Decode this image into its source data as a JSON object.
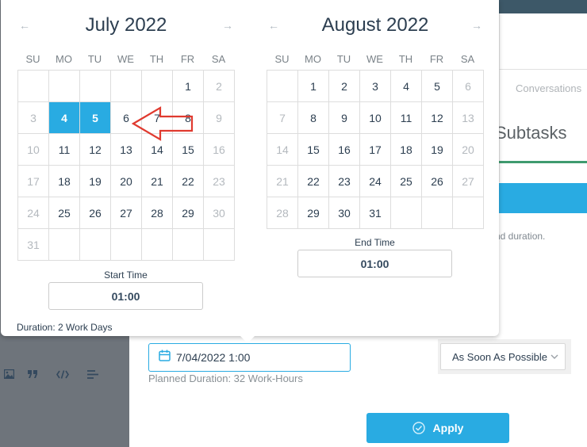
{
  "background": {
    "tab_conversations": "Conversations",
    "section_subtasks": "Subtasks",
    "duration_note": "nd duration."
  },
  "editor_toolbar": {
    "icons": [
      "image-icon",
      "quote-icon",
      "code-icon",
      "align-left-icon"
    ]
  },
  "scheduling": {
    "date_value": "7/04/2022 1:00",
    "planned_duration": "Planned Duration: 32 Work-Hours",
    "constraint": "As Soon As Possible",
    "apply_label": "Apply"
  },
  "picker": {
    "calendars": [
      {
        "title": "July 2022",
        "weekdays": [
          "SU",
          "MO",
          "TU",
          "WE",
          "TH",
          "FR",
          "SA"
        ],
        "weeks": [
          [
            {
              "t": ""
            },
            {
              "t": ""
            },
            {
              "t": ""
            },
            {
              "t": ""
            },
            {
              "t": ""
            },
            {
              "t": "1"
            },
            {
              "t": "2",
              "m": true
            }
          ],
          [
            {
              "t": "3",
              "m": true
            },
            {
              "t": "4",
              "s": true
            },
            {
              "t": "5",
              "s": true
            },
            {
              "t": "6"
            },
            {
              "t": "7"
            },
            {
              "t": "8"
            },
            {
              "t": "9",
              "m": true
            }
          ],
          [
            {
              "t": "10",
              "m": true
            },
            {
              "t": "11"
            },
            {
              "t": "12"
            },
            {
              "t": "13"
            },
            {
              "t": "14"
            },
            {
              "t": "15"
            },
            {
              "t": "16",
              "m": true
            }
          ],
          [
            {
              "t": "17",
              "m": true
            },
            {
              "t": "18"
            },
            {
              "t": "19"
            },
            {
              "t": "20"
            },
            {
              "t": "21"
            },
            {
              "t": "22"
            },
            {
              "t": "23",
              "m": true
            }
          ],
          [
            {
              "t": "24",
              "m": true
            },
            {
              "t": "25"
            },
            {
              "t": "26"
            },
            {
              "t": "27"
            },
            {
              "t": "28"
            },
            {
              "t": "29"
            },
            {
              "t": "30",
              "m": true
            }
          ],
          [
            {
              "t": "31",
              "m": true
            },
            {
              "t": ""
            },
            {
              "t": ""
            },
            {
              "t": ""
            },
            {
              "t": ""
            },
            {
              "t": ""
            },
            {
              "t": ""
            }
          ]
        ],
        "time_label": "Start Time",
        "time_value": "01:00"
      },
      {
        "title": "August 2022",
        "weekdays": [
          "SU",
          "MO",
          "TU",
          "WE",
          "TH",
          "FR",
          "SA"
        ],
        "weeks": [
          [
            {
              "t": ""
            },
            {
              "t": "1"
            },
            {
              "t": "2"
            },
            {
              "t": "3"
            },
            {
              "t": "4"
            },
            {
              "t": "5"
            },
            {
              "t": "6",
              "m": true
            }
          ],
          [
            {
              "t": "7",
              "m": true
            },
            {
              "t": "8"
            },
            {
              "t": "9"
            },
            {
              "t": "10"
            },
            {
              "t": "11"
            },
            {
              "t": "12"
            },
            {
              "t": "13",
              "m": true
            }
          ],
          [
            {
              "t": "14",
              "m": true
            },
            {
              "t": "15"
            },
            {
              "t": "16"
            },
            {
              "t": "17"
            },
            {
              "t": "18"
            },
            {
              "t": "19"
            },
            {
              "t": "20",
              "m": true
            }
          ],
          [
            {
              "t": "21",
              "m": true
            },
            {
              "t": "22"
            },
            {
              "t": "23"
            },
            {
              "t": "24"
            },
            {
              "t": "25"
            },
            {
              "t": "26"
            },
            {
              "t": "27",
              "m": true
            }
          ],
          [
            {
              "t": "28",
              "m": true
            },
            {
              "t": "29"
            },
            {
              "t": "30"
            },
            {
              "t": "31"
            },
            {
              "t": ""
            },
            {
              "t": ""
            },
            {
              "t": ""
            }
          ]
        ],
        "time_label": "End Time",
        "time_value": "01:00"
      }
    ],
    "duration": "Duration: 2 Work Days"
  },
  "colors": {
    "accent": "#29abe2",
    "annotation": "#e03a2f",
    "muted_day": "#b4b9be"
  }
}
